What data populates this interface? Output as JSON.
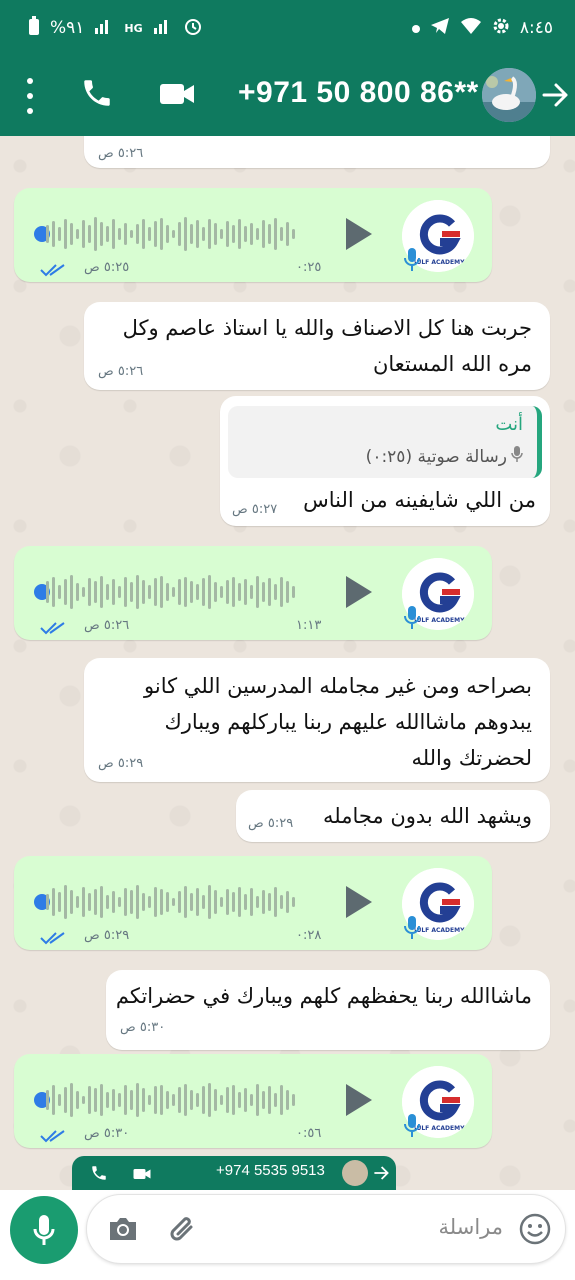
{
  "status_bar": {
    "time": "٨:٤٥",
    "battery": "%٩١",
    "network": "HG"
  },
  "header": {
    "contact": "+971 50 800 86**"
  },
  "messages": [
    {
      "id": "m0",
      "type": "text",
      "dir": "in",
      "time": "٥:٢٦ ص"
    },
    {
      "id": "m1",
      "type": "voice",
      "dir": "out",
      "duration": "٠:٢٥",
      "time": "٥:٢٥ ص",
      "logo": "GULF ACADEMY"
    },
    {
      "id": "m2",
      "type": "text",
      "dir": "in",
      "text": "جربت هنا كل الاصناف والله يا استاذ عاصم وكل مره الله المستعان",
      "time": "٥:٢٦ ص"
    },
    {
      "id": "m3",
      "type": "reply",
      "dir": "in",
      "quote_author": "أنت",
      "quote_text": "رسالة صوتية (٠:٢٥)",
      "text": "من اللي شايفينه من الناس",
      "time": "٥:٢٧ ص"
    },
    {
      "id": "m4",
      "type": "voice",
      "dir": "out",
      "duration": "١:١٣",
      "time": "٥:٢٦ ص",
      "logo": "GULF ACADEMY"
    },
    {
      "id": "m5",
      "type": "text",
      "dir": "in",
      "text": "بصراحه ومن غير مجامله المدرسين اللي كانو يبدوهم ماشاالله عليهم ربنا يباركلهم ويبارك لحضرتك والله",
      "time": "٥:٢٩ ص"
    },
    {
      "id": "m6",
      "type": "text",
      "dir": "in",
      "text": "ويشهد الله بدون مجامله",
      "time": "٥:٢٩ ص"
    },
    {
      "id": "m7",
      "type": "voice",
      "dir": "out",
      "duration": "٠:٢٨",
      "time": "٥:٢٩ ص",
      "logo": "GULF ACADEMY"
    },
    {
      "id": "m8",
      "type": "text",
      "dir": "in",
      "text": "ماشاالله ربنا يحفظهم كلهم ويبارك في حضراتكم",
      "time": "٥:٣٠ ص"
    },
    {
      "id": "m9",
      "type": "voice",
      "dir": "out",
      "duration": "٠:٥٦",
      "time": "٥:٣٠ ص",
      "logo": "GULF ACADEMY"
    }
  ],
  "mini_card": {
    "contact": "+974 5535 9513"
  },
  "composer": {
    "placeholder": "مراسلة"
  },
  "colors": {
    "header": "#0f7a5f",
    "outgoing": "#d8fdd2",
    "incoming": "#ffffff",
    "accent": "#25a67e",
    "tick": "#2e7ce6"
  }
}
